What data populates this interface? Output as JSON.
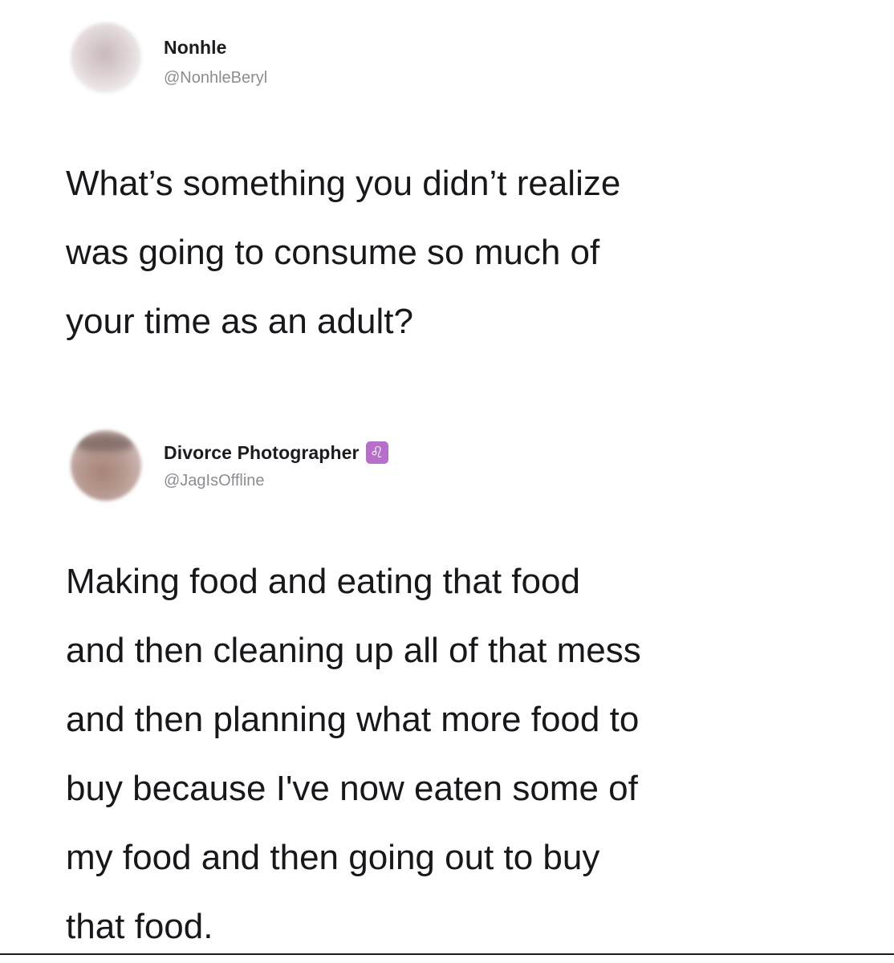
{
  "tweets": [
    {
      "display_name": "Nonhle",
      "handle": "@NonhleBeryl",
      "text": "What’s something you didn’t realize\nwas going to consume so much of\nyour time as an adult?"
    },
    {
      "display_name": "Divorce Photographer",
      "badge": "♌",
      "handle": "@JagIsOffline",
      "text": "Making food and eating that food\nand then cleaning up all of that mess\nand then planning what more food to\nbuy because I've now eaten some of\nmy food and then going out to buy\nthat food."
    }
  ],
  "colors": {
    "background": "#ffffff",
    "text": "#17181c",
    "handle": "#8a8d92",
    "badge": "#b86fc9"
  },
  "icons": {
    "badge": "leo-zodiac-icon"
  }
}
